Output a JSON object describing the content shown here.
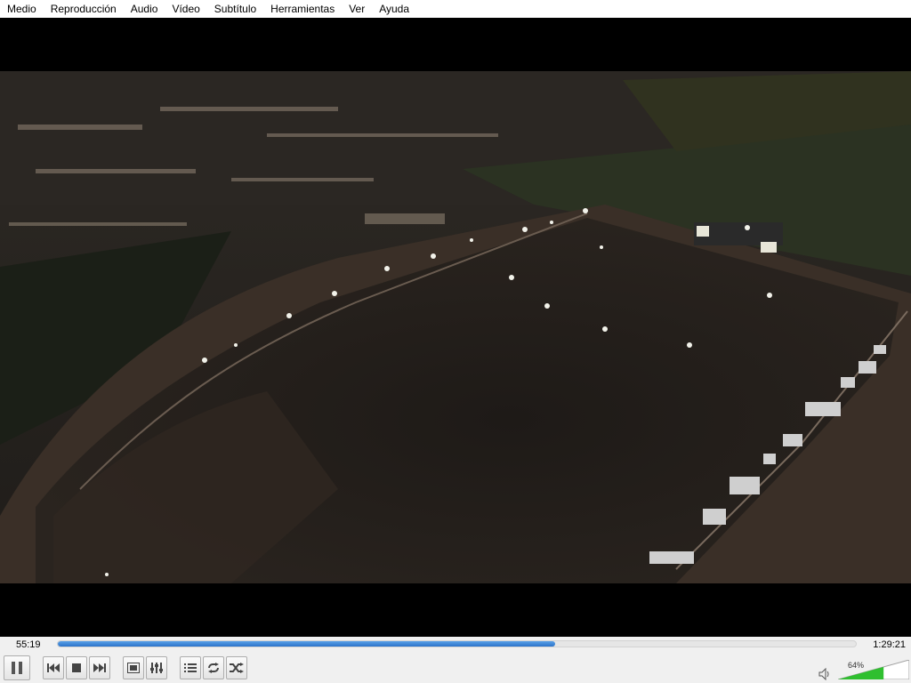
{
  "menu": {
    "items": [
      "Medio",
      "Reproducción",
      "Audio",
      "Vídeo",
      "Subtítulo",
      "Herramientas",
      "Ver",
      "Ayuda"
    ]
  },
  "playback": {
    "time_elapsed": "55:19",
    "time_total": "1:29:21",
    "progress_fraction": 0.623
  },
  "volume": {
    "percent_label": "64%",
    "level_fraction": 0.64
  },
  "colors": {
    "seek_fill": "#2b73c9",
    "volume_fill": "#2fbf2f"
  },
  "icons": {
    "play_pause": "pause-icon",
    "prev": "previous-icon",
    "stop": "stop-icon",
    "next": "next-icon",
    "fullscreen": "fullscreen-icon",
    "extended": "equalizer-icon",
    "playlist": "playlist-icon",
    "loop": "loop-icon",
    "random": "shuffle-icon",
    "volume": "speaker-icon"
  }
}
